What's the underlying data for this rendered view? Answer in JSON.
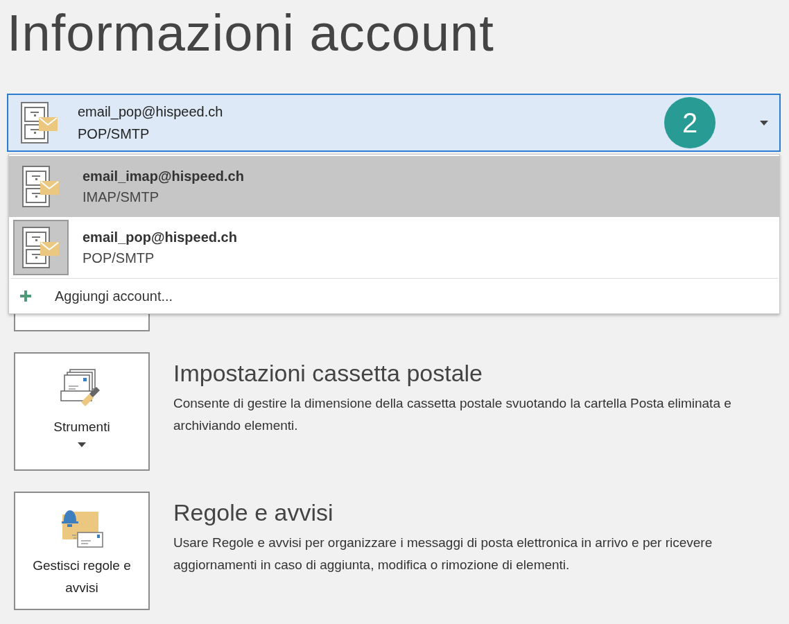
{
  "title": "Informazioni account",
  "account_selector": {
    "email": "email_pop@hispeed.ch",
    "type": "POP/SMTP",
    "badge": "2",
    "expanded": true
  },
  "dropdown": {
    "items": [
      {
        "email": "email_imap@hispeed.ch",
        "type": "IMAP/SMTP",
        "hovered": true,
        "selected": false
      },
      {
        "email": "email_pop@hispeed.ch",
        "type": "POP/SMTP",
        "hovered": false,
        "selected": true
      }
    ],
    "add_label": "Aggiungi account..."
  },
  "sections": [
    {
      "kind": "hidden"
    },
    {
      "kind": "tools",
      "button": "Strumenti",
      "has_menu": true,
      "heading": "Impostazioni cassetta postale",
      "description": "Consente di gestire la dimensione della cassetta postale svuotando la cartella Posta eliminata e archiviando elementi."
    },
    {
      "kind": "rules",
      "button": "Gestisci regole e avvisi",
      "has_menu": false,
      "heading": "Regole e avvisi",
      "description": "Usare Regole e avvisi per organizzare i messaggi di posta elettronica in arrivo e per ricevere aggiornamenti in caso di aggiunta, modifica o rimozione di elementi."
    }
  ]
}
